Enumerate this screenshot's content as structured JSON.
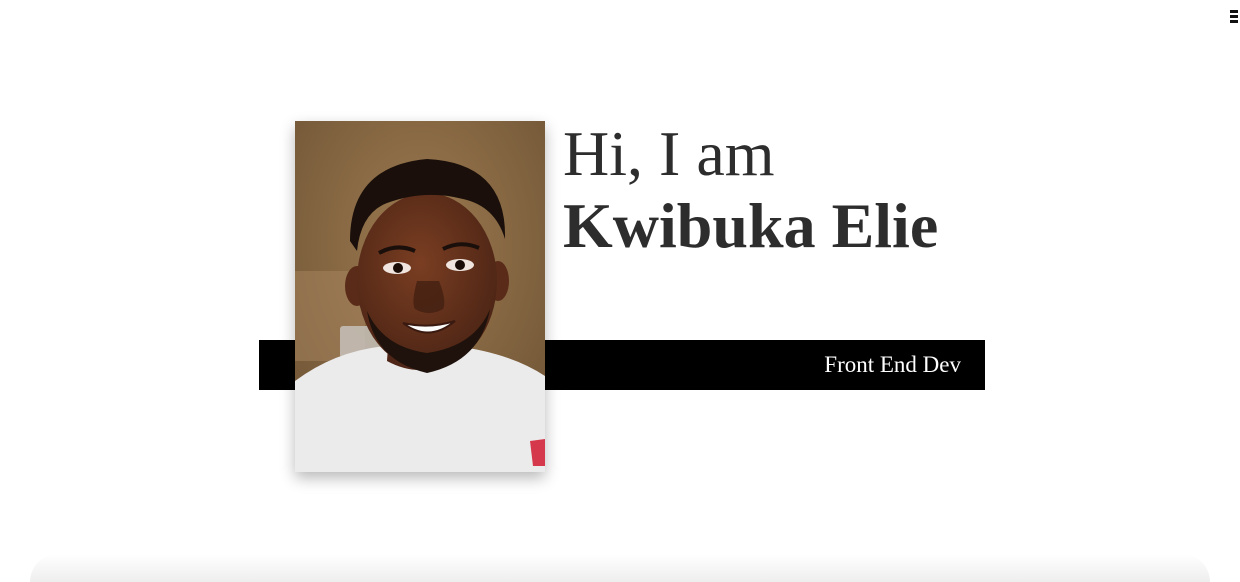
{
  "header": {
    "menu_icon": "hamburger-menu-icon"
  },
  "hero": {
    "greeting": "Hi, I am",
    "name": "Kwibuka Elie",
    "role": "Front End Dev",
    "photo_icon": "profile-photo"
  },
  "colors": {
    "text": "#2d2d2d",
    "band": "#000000",
    "band_text": "#ffffff",
    "background": "#ffffff"
  }
}
